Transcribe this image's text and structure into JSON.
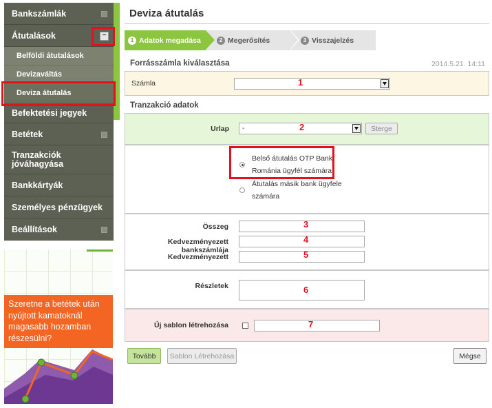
{
  "sidebar": {
    "items": [
      {
        "label": "Bankszámlák"
      },
      {
        "label": "Átutalások"
      },
      {
        "label": "Befektetési jegyek"
      },
      {
        "label": "Betétek"
      },
      {
        "label": "Tranzakciók jóváhagyása"
      },
      {
        "label": "Bankkártyák"
      },
      {
        "label": "Személyes pénzügyek"
      },
      {
        "label": "Beállítások"
      }
    ],
    "sub_items": [
      {
        "label": "Belföldi átutalások"
      },
      {
        "label": "Devizaváltás"
      },
      {
        "label": "Deviza átutalás"
      }
    ],
    "minus_glyph": "−"
  },
  "promo": {
    "text": "Szeretne a betétek után nyújtott kamatoknál magasabb hozamban részesülni?",
    "colors": {
      "orange": "#f26522",
      "purple": "#7b3fa0",
      "green": "#6cb33f"
    }
  },
  "page": {
    "title": "Deviza átutalás"
  },
  "steps": [
    {
      "num": "1",
      "label": "Adatok megadása",
      "active": true
    },
    {
      "num": "2",
      "label": "Megerősítés",
      "active": false
    },
    {
      "num": "3",
      "label": "Visszajelzés",
      "active": false
    }
  ],
  "source": {
    "heading": "Forrásszámla kiválasztása",
    "datetime": "2014.5.21. 14:11",
    "account_label": "Számla",
    "account_value": "",
    "marker": "1"
  },
  "transaction": {
    "heading": "Tranzakció adatok",
    "form_label": "Urlap",
    "form_value": "-",
    "form_marker": "2",
    "clear_button": "Sterge",
    "radio_internal_line1": "Belső átutalás OTP Bank",
    "radio_internal_line2": "Románia ügyfél számára",
    "radio_external_line1": "Átutalás másik bank ügyfele",
    "radio_external_line2": "számára",
    "amount_label": "Összeg",
    "amount_marker": "3",
    "beneficiary_account_label": "Kedvezményezett bankszámlája",
    "beneficiary_account_marker": "4",
    "beneficiary_label": "Kedvezményezett",
    "beneficiary_marker": "5",
    "details_label": "Részletek",
    "details_marker": "6",
    "template_label": "Új sablon létrehozása",
    "template_marker": "7"
  },
  "buttons": {
    "next": "Tovább",
    "create_template": "Sablon Létrehozása",
    "cancel": "Mégse"
  },
  "colors": {
    "accent_green": "#8cc63f",
    "highlight_red": "#e3101d",
    "sidebar_dark": "#5d6153"
  }
}
